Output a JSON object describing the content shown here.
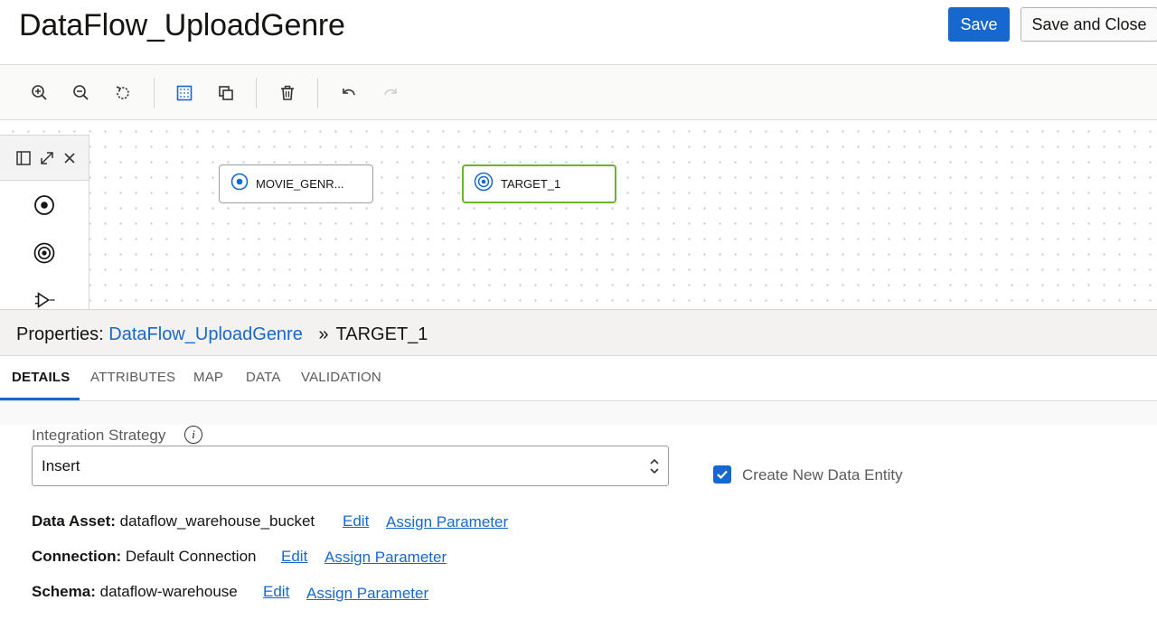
{
  "header": {
    "title": "DataFlow_UploadGenre",
    "save_label": "Save",
    "save_close_label": "Save and Close"
  },
  "toolbar": {
    "icons": [
      "zoom-in-icon",
      "zoom-out-icon",
      "reset-icon",
      "grid-icon",
      "copy-icon",
      "delete-icon",
      "undo-icon",
      "redo-icon"
    ]
  },
  "canvas": {
    "nodes": [
      {
        "label": "MOVIE_GENR..."
      },
      {
        "label": "TARGET_1"
      }
    ]
  },
  "properties": {
    "prefix": "Properties:",
    "flow_link": "DataFlow_UploadGenre",
    "separator": "»",
    "current": "TARGET_1"
  },
  "tabs": [
    "DETAILS",
    "ATTRIBUTES",
    "MAP",
    "DATA",
    "VALIDATION"
  ],
  "details": {
    "strategy_label": "Integration Strategy",
    "info_glyph": "i",
    "strategy_value": "Insert",
    "create_entity_label": "Create New Data Entity",
    "create_entity_checked": true,
    "data_asset_label": "Data Asset:",
    "data_asset_value": "dataflow_warehouse_bucket",
    "connection_label": "Connection:",
    "connection_value": "Default Connection",
    "schema_label": "Schema:",
    "schema_value": "dataflow-warehouse",
    "edit_label": "Edit",
    "assign_label": "Assign Parameter"
  },
  "colors": {
    "accent": "#1768ce",
    "target_border": "#6bb527",
    "source_border": "#9e9e9e"
  }
}
